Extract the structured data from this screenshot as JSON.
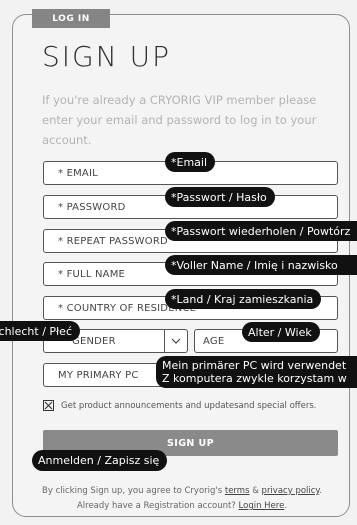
{
  "login_tab": "LOG IN",
  "title": "SIGN UP",
  "intro": "If you're already a CRYORIG VIP member please enter your email and password to log in to your account.",
  "fields": {
    "email": "* EMAIL",
    "password": "* PASSWORD",
    "repeat_password": "* REPEAT PASSWORD",
    "full_name": "* FULL NAME",
    "country": "* COUNTRY OF RESIDENCE",
    "gender": "GENDER",
    "age": "AGE",
    "primary_pc": "MY PRIMARY PC"
  },
  "tooltips": {
    "email": "*Email",
    "password": "*Passwort / Hasło",
    "repeat_password": "*Passwort wiederholen / Powtórz",
    "full_name": "*Voller Name / Imię i nazwisko",
    "country": "*Land / Kraj zamieszkania",
    "gender": "Geschlecht / Płeć",
    "age": "Alter / Wiek",
    "primary_pc_line1": "Mein primärer PC wird verwendet",
    "primary_pc_line2": "Z komputera zwykle korzystam w",
    "sign_up": "Anmelden / Zapisz się"
  },
  "checkbox": {
    "checked": true,
    "label": "Get product announcements and updatesand special offers."
  },
  "signup_button": "SIGN UP",
  "footer": {
    "line1_prefix": "By clicking Sign up, you agree to Cryorig's",
    "terms_link": "terms",
    "and": "&",
    "privacy_link": "privacy policy",
    "period": ".",
    "line2_prefix": "Already have a Registration account?",
    "login_link": "Login Here",
    "line2_suffix": "."
  }
}
